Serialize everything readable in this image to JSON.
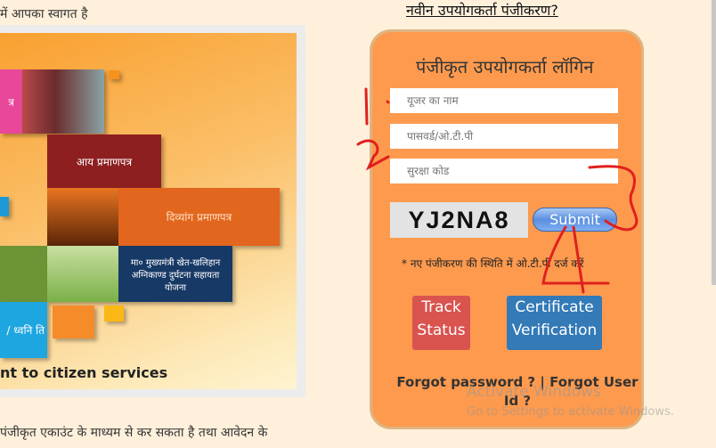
{
  "welcome_text": "में आपका स्वागत है",
  "banner": {
    "tiles": [
      "त्र",
      "आय प्रमाणपत्र",
      "दिव्यांग प्रमाणपत्र",
      "मा० मुख्यमंत्री खेत-खलिहान अग्निकाण्ड दुर्घटना सहायता योजना",
      "/ ध्वनि ति"
    ],
    "tagline": "nt to citizen services"
  },
  "register_link": "नवीन उपयोगकर्ता पंजीकरण?",
  "login": {
    "title": "पंजीकृत उपयोगकर्ता लॉगिन",
    "username_placeholder": "यूजर का नाम",
    "password_placeholder": "पासवर्ड/ओ.टी.पी",
    "security_code_placeholder": "सुरक्षा कोड",
    "captcha": "YJ2NA8",
    "submit_label": "Submit",
    "otp_note": "* नए पंजीकरण की स्थिति में ओ.टी.पी दर्ज करें",
    "track_status_label": "Track Status",
    "certificate_verification_label": "Certificate Verification",
    "forgot_password": "Forgot password ?",
    "separator": "|",
    "forgot_user_id": "Forgot User Id ?"
  },
  "annotations": [
    "1",
    "2",
    "3",
    "4"
  ],
  "watermark": {
    "line1": "Activate Windows",
    "line2": "Go to Settings to activate Windows."
  },
  "body_text": "पंजीकृत एकाउंट के माध्यम से कर सकता है तथा आवेदन के",
  "colors": {
    "card": "#fd9a4e",
    "track": "#d9534f",
    "cert": "#337ab7",
    "annotation": "#e0201e"
  }
}
